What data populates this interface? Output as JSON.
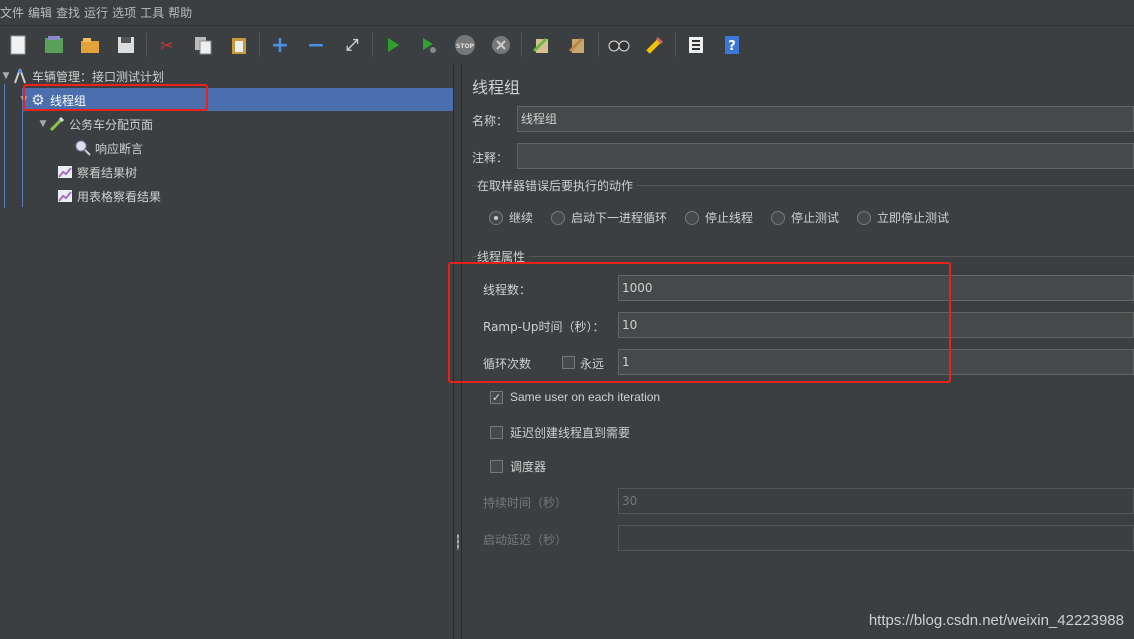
{
  "menu": [
    "文件",
    "编辑",
    "查找",
    "运行",
    "选项",
    "工具",
    "帮助"
  ],
  "toolbar_icons": [
    "new-icon",
    "templates-icon",
    "open-icon",
    "save-icon",
    "cut-icon",
    "copy-icon",
    "paste-icon",
    "expand-icon",
    "collapse-icon",
    "toggle-icon",
    "start-icon",
    "start-no-pause-icon",
    "stop-icon",
    "shutdown-icon",
    "clear-icon",
    "clear-all-icon",
    "search-icon",
    "reset-search-icon",
    "function-helper-icon",
    "help-icon"
  ],
  "tree": {
    "root": "车辆管理：接口测试计划",
    "thread_group": "线程组",
    "sampler": "公务车分配页面",
    "assertion": "响应断言",
    "listener1": "察看结果树",
    "listener2": "用表格察看结果"
  },
  "panel": {
    "title": "线程组",
    "name_label": "名称：",
    "name_value": "线程组",
    "comment_label": "注释：",
    "comment_value": "",
    "error_group_title": "在取样器错误后要执行的动作",
    "error_options": [
      "继续",
      "启动下一进程循环",
      "停止线程",
      "停止测试",
      "立即停止测试"
    ],
    "error_selected": "继续",
    "props_title": "线程属性",
    "threads_label": "线程数：",
    "threads_value": "1000",
    "rampup_label": "Ramp-Up时间（秒）：",
    "rampup_value": "10",
    "loop_label": "循环次数",
    "forever_label": "永远",
    "forever_checked": false,
    "loop_value": "1",
    "same_user_label": "Same user on each iteration",
    "same_user_checked": true,
    "delay_label": "延迟创建线程直到需要",
    "delay_checked": false,
    "scheduler_label": "调度器",
    "scheduler_checked": false,
    "duration_label": "持续时间（秒）",
    "duration_value": "30",
    "startup_delay_label": "启动延迟（秒）",
    "startup_delay_value": ""
  },
  "watermark": "https://blog.csdn.net/weixin_42223988",
  "colors": {
    "background": "#3c3f41",
    "selection": "#4b6eaf",
    "highlight_box": "#e8211a"
  }
}
